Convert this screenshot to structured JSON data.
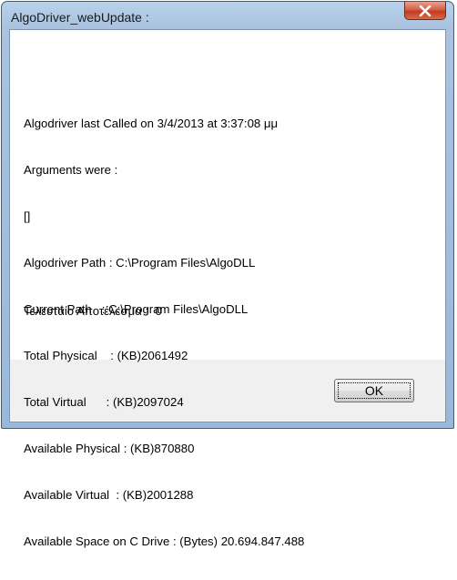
{
  "window": {
    "title": "AlgoDriver_webUpdate :"
  },
  "message": {
    "lines": [
      "Algodriver last Called on 3/4/2013 at 3:37:08 μμ",
      "Arguments were :",
      "[]",
      "Algodriver Path : C:\\Program Files\\AlgoDLL",
      "Current Path   : C:\\Program Files\\AlgoDLL",
      "Total Physical    : (KB)2061492",
      "Total Virtual      : (KB)2097024",
      "Available Physical : (KB)870880",
      "Available Virtual  : (KB)2001288",
      "Available Space on C Drive : (Bytes) 20.694.847.488"
    ],
    "result": "Τελευταίο Αποτέλεσμα :  0"
  },
  "buttons": {
    "ok_label": "OK"
  },
  "icons": {
    "close": "close-icon"
  }
}
